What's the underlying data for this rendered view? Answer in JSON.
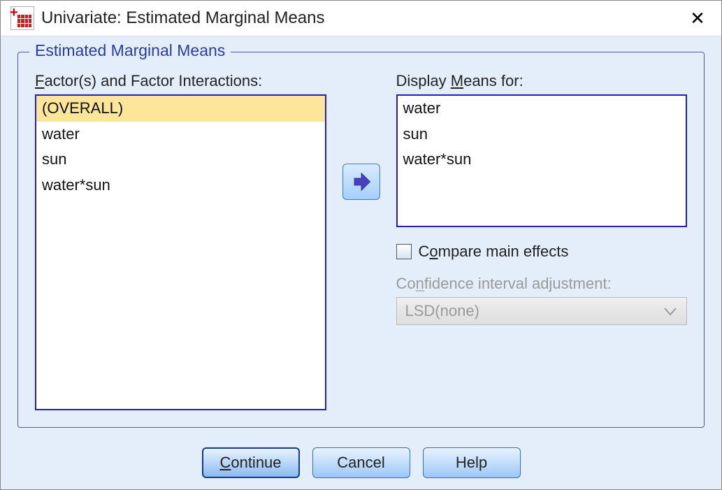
{
  "title": "Univariate: Estimated Marginal Means",
  "fieldset_legend": "Estimated Marginal Means",
  "left": {
    "label_pre": "F",
    "label_post": "actor(s) and Factor Interactions:",
    "items": [
      "(OVERALL)",
      "water",
      "sun",
      "water*sun"
    ],
    "selected_index": 0
  },
  "right": {
    "label_pre": "Display ",
    "label_mn": "M",
    "label_post": "eans for:",
    "items": [
      "water",
      "sun",
      "water*sun"
    ]
  },
  "compare": {
    "checked": false,
    "label_pre": "C",
    "label_mn": "o",
    "label_post": "mpare main effects"
  },
  "ci": {
    "label_pre": "Co",
    "label_mn": "n",
    "label_post": "fidence interval adjustment:",
    "value": "LSD(none)"
  },
  "buttons": {
    "continue_mn": "C",
    "continue_post": "ontinue",
    "cancel": "Cancel",
    "help": "Help"
  }
}
